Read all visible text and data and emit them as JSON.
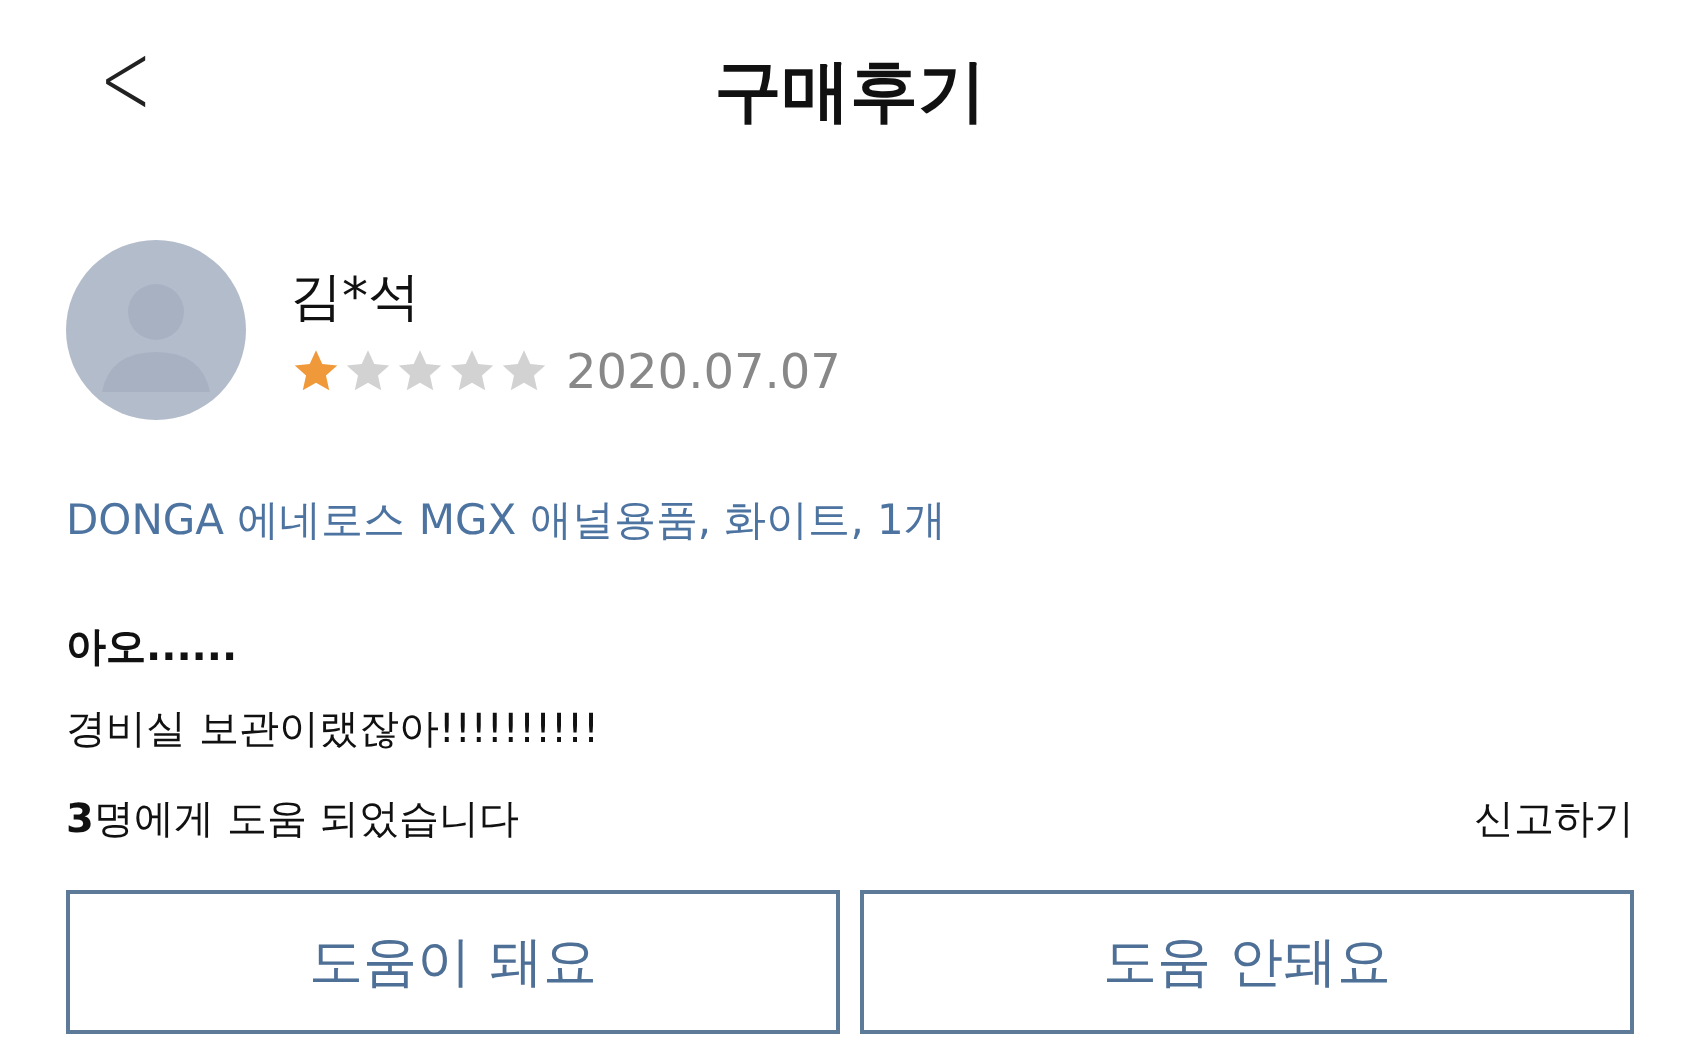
{
  "header": {
    "back": "<",
    "title": "구매후기"
  },
  "review": {
    "author": "김*석",
    "stars": 1,
    "date": "2020.07.07",
    "product": "DONGA 에네로스 MGX 애널용품, 화이트, 1개",
    "headline": "아오......",
    "body": "경비실 보관이랬잖아!!!!!!!!!!",
    "helpful": "**3**명에게 도움 되었습니다",
    "report": "신고하기"
  },
  "buttons": [
    {
      "label": "도움이 돼요"
    },
    {
      "label": "도움 안돼요"
    }
  ]
}
